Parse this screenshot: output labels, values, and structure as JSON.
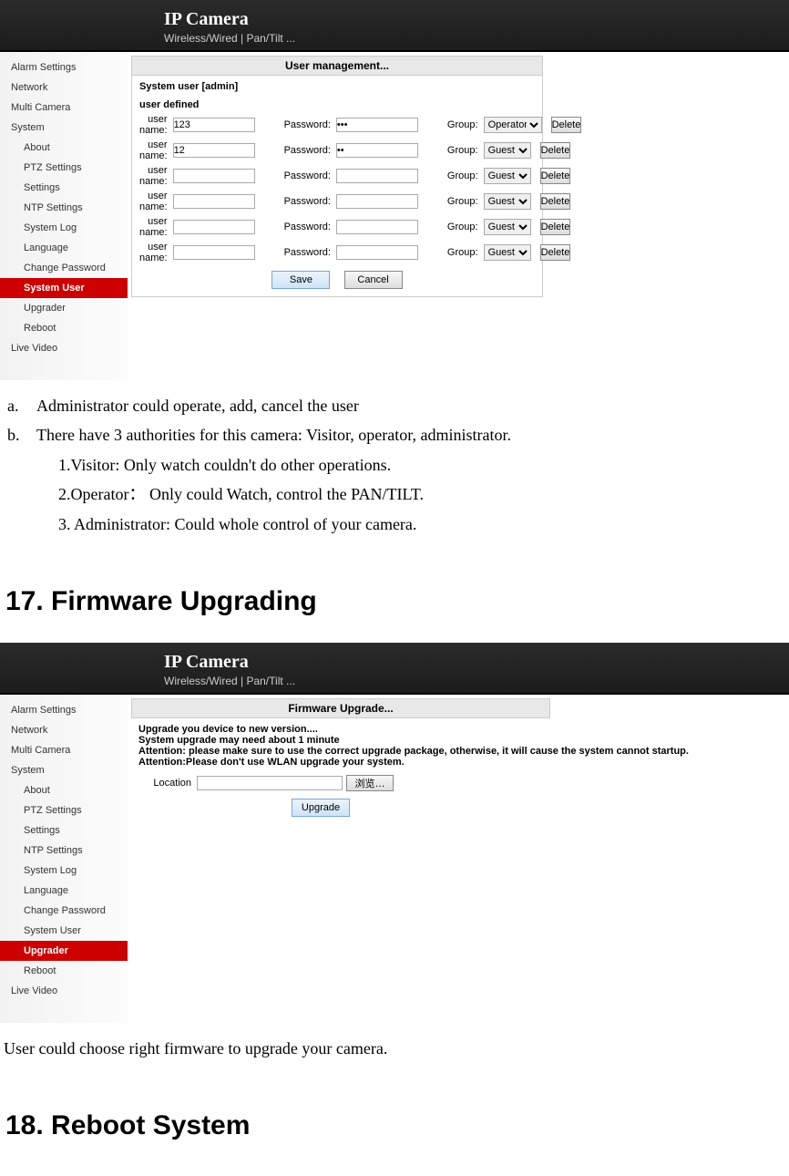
{
  "app1": {
    "brand": "IP Camera",
    "sub": "Wireless/Wired  |  Pan/Tilt  ...",
    "sidebar": {
      "items": [
        {
          "label": "Alarm Settings",
          "type": "item"
        },
        {
          "label": "Network",
          "type": "item"
        },
        {
          "label": "Multi Camera",
          "type": "item"
        },
        {
          "label": "System",
          "type": "item"
        },
        {
          "label": "About",
          "type": "sub"
        },
        {
          "label": "PTZ Settings",
          "type": "sub"
        },
        {
          "label": "Settings",
          "type": "sub"
        },
        {
          "label": "NTP Settings",
          "type": "sub"
        },
        {
          "label": "System Log",
          "type": "sub"
        },
        {
          "label": "Language",
          "type": "sub"
        },
        {
          "label": "Change Password",
          "type": "sub"
        },
        {
          "label": "System User",
          "type": "sub",
          "active": true
        },
        {
          "label": "Upgrader",
          "type": "sub"
        },
        {
          "label": "Reboot",
          "type": "sub"
        },
        {
          "label": "Live Video",
          "type": "item"
        }
      ]
    },
    "panel": {
      "title": "User  management...",
      "system_user_label": "System user [admin]",
      "user_defined_label": "user defined",
      "username_label": "user name:",
      "password_label": "Password:",
      "group_label": "Group:",
      "delete_label": "Delete",
      "save_label": "Save",
      "cancel_label": "Cancel",
      "rows": [
        {
          "username": "123",
          "password": "•••",
          "group": "Operator"
        },
        {
          "username": "12",
          "password": "••",
          "group": "Guest"
        },
        {
          "username": "",
          "password": "",
          "group": "Guest"
        },
        {
          "username": "",
          "password": "",
          "group": "Guest"
        },
        {
          "username": "",
          "password": "",
          "group": "Guest"
        },
        {
          "username": "",
          "password": "",
          "group": "Guest"
        }
      ]
    }
  },
  "doc1": {
    "a": "Administrator could operate, add, cancel the user",
    "b": "There have 3 authorities for this camera: Visitor, operator, administrator.",
    "b1": "1.Visitor: Only watch couldn't do other operations.",
    "b2": "2.Operator： Only could Watch, control the PAN/TILT.",
    "b3": "3. Administrator: Could whole control of your camera.",
    "h17": "17. Firmware Upgrading"
  },
  "app2": {
    "brand": "IP Camera",
    "sub": "Wireless/Wired  |  Pan/Tilt  ...",
    "sidebar": {
      "items": [
        {
          "label": "Alarm Settings",
          "type": "item"
        },
        {
          "label": "Network",
          "type": "item"
        },
        {
          "label": "Multi Camera",
          "type": "item"
        },
        {
          "label": "System",
          "type": "item"
        },
        {
          "label": "About",
          "type": "sub"
        },
        {
          "label": "PTZ Settings",
          "type": "sub"
        },
        {
          "label": "Settings",
          "type": "sub"
        },
        {
          "label": "NTP Settings",
          "type": "sub"
        },
        {
          "label": "System Log",
          "type": "sub"
        },
        {
          "label": "Language",
          "type": "sub"
        },
        {
          "label": "Change Password",
          "type": "sub"
        },
        {
          "label": "System User",
          "type": "sub"
        },
        {
          "label": "Upgrader",
          "type": "sub",
          "active": true
        },
        {
          "label": "Reboot",
          "type": "sub"
        },
        {
          "label": "Live Video",
          "type": "item"
        }
      ]
    },
    "panel": {
      "title": "Firmware Upgrade...",
      "line1": "Upgrade you device to new version....",
      "line2": "System upgrade may need about 1 minute",
      "line3": "Attention: please make sure to use the correct upgrade package, otherwise, it will cause the system cannot startup.",
      "line4": "Attention:Please don't use WLAN upgrade your system.",
      "location_label": "Location",
      "location_value": "",
      "browse_label": "浏览…",
      "upgrade_label": "Upgrade"
    }
  },
  "doc2": {
    "p": "User could choose right firmware to upgrade your camera.",
    "h18": "18. Reboot System"
  }
}
